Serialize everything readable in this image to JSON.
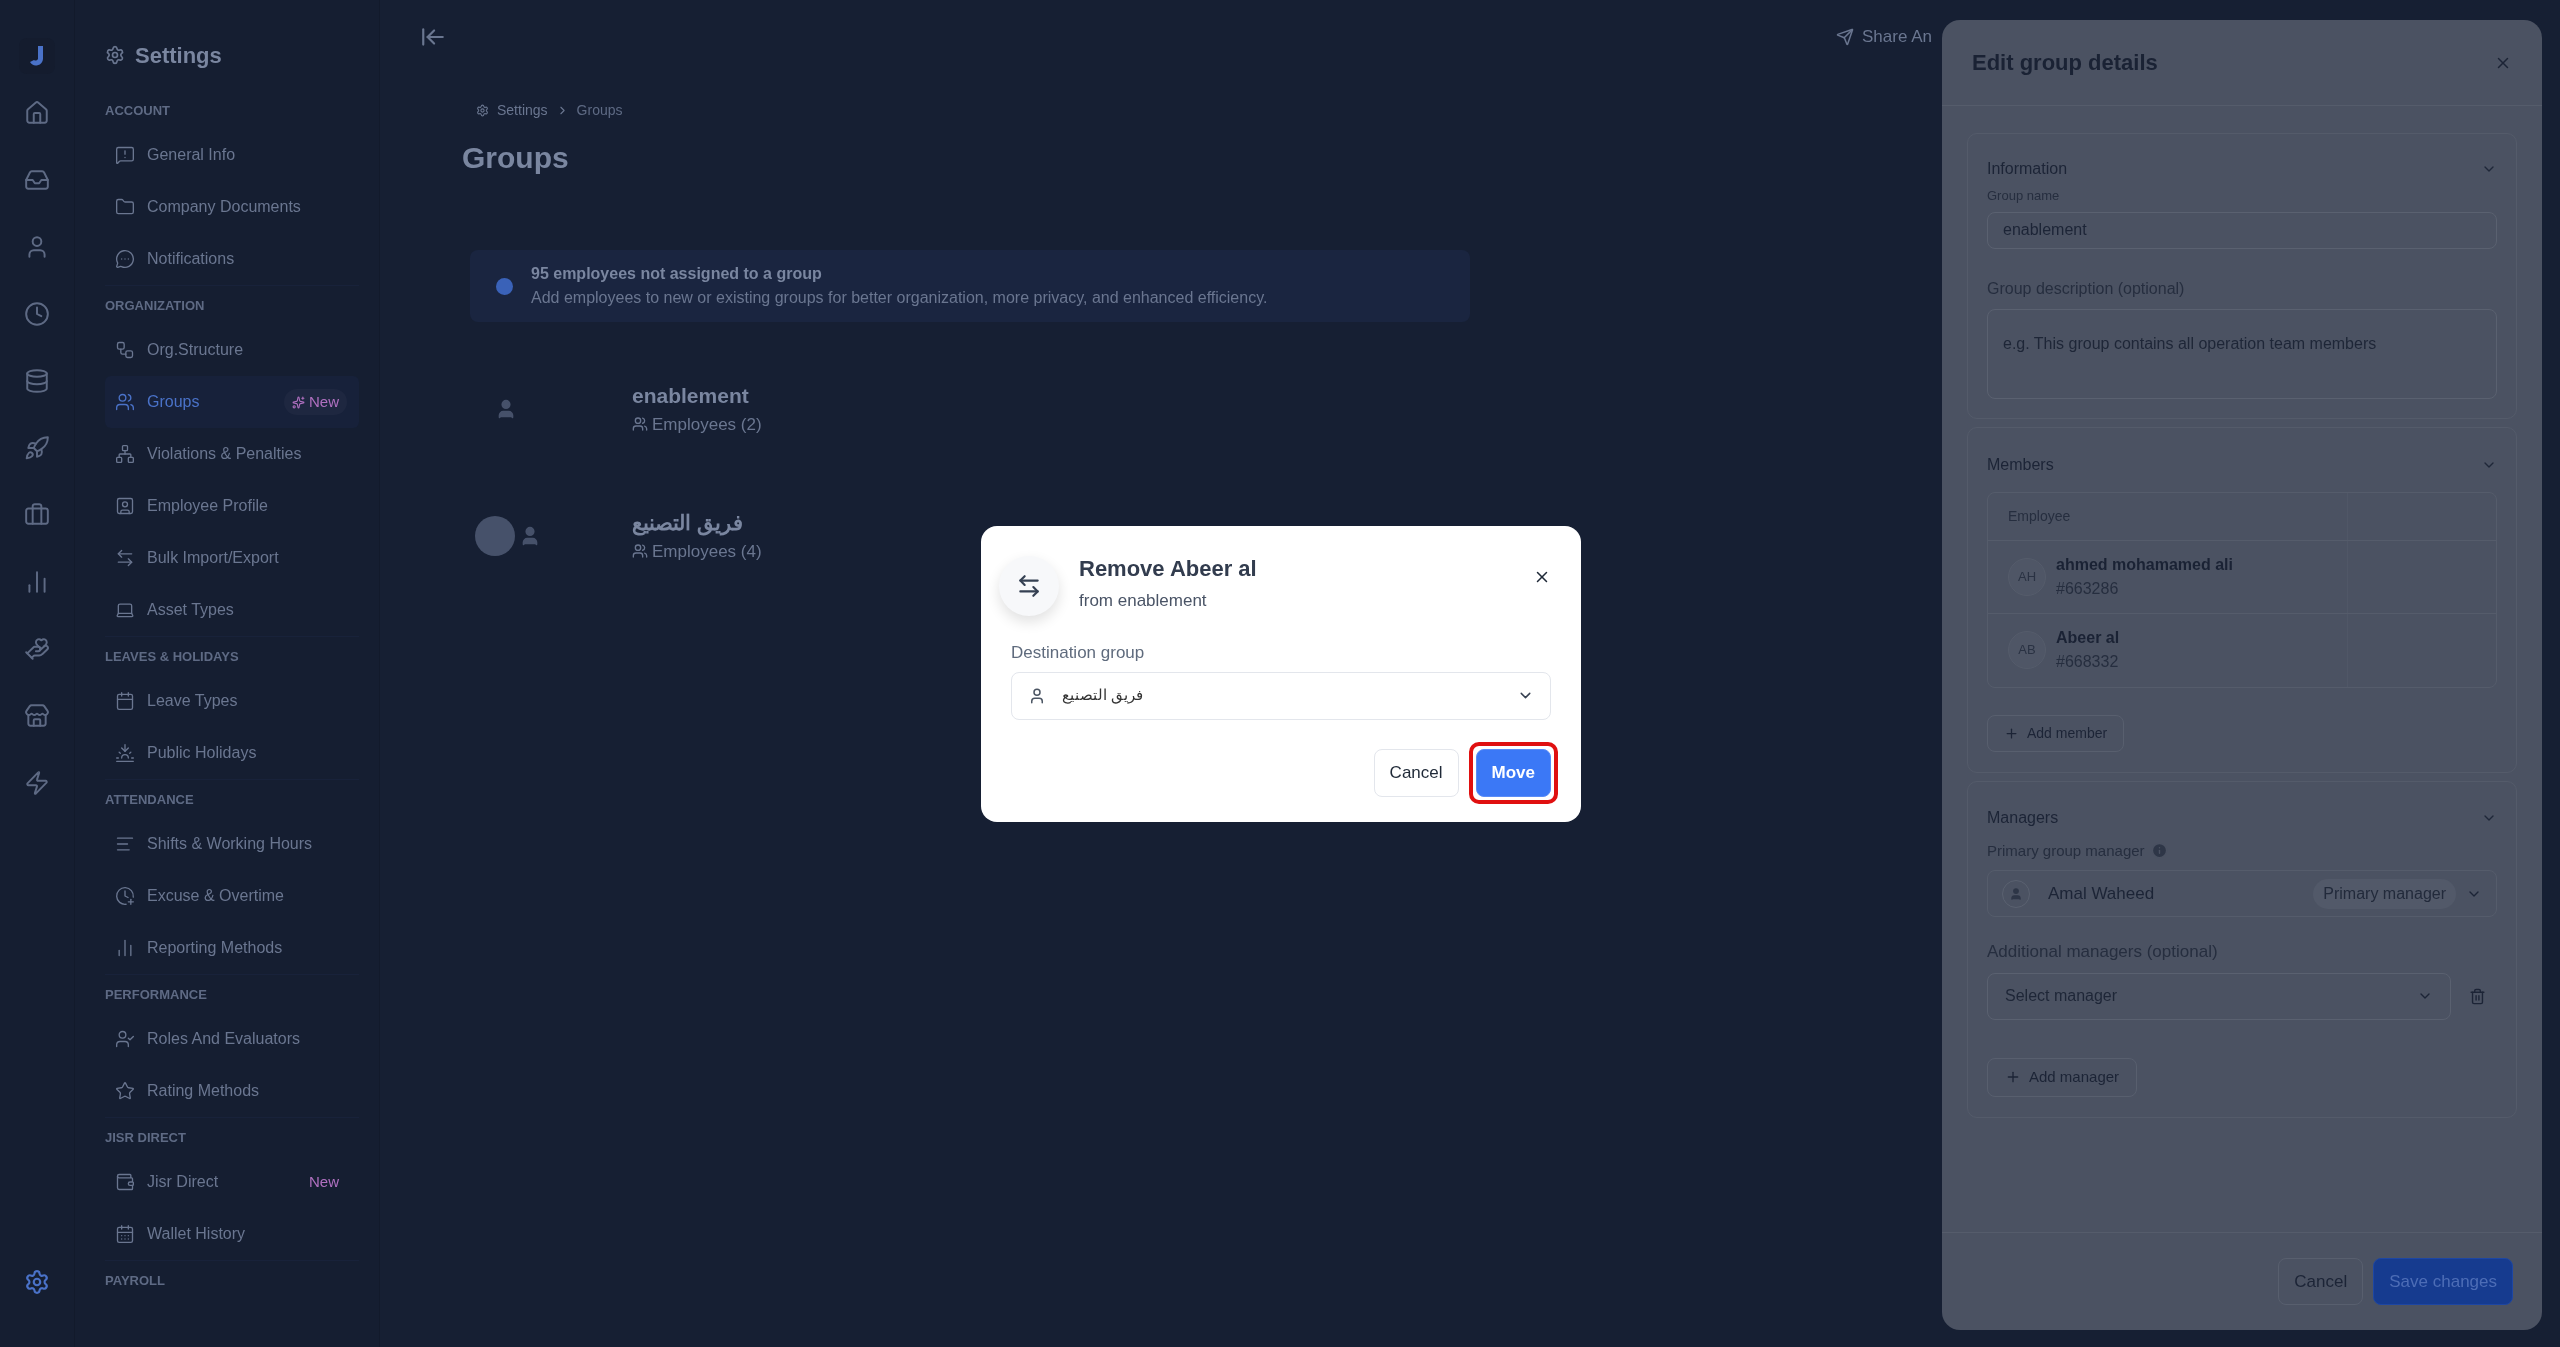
{
  "sidebar": {
    "title": "Settings",
    "sections": [
      {
        "label": "ACCOUNT",
        "items": [
          {
            "label": "General Info",
            "selected": false
          },
          {
            "label": "Company Documents",
            "selected": false
          },
          {
            "label": "Notifications",
            "selected": false
          }
        ]
      },
      {
        "label": "ORGANIZATION",
        "items": [
          {
            "label": "Org.Structure",
            "selected": false
          },
          {
            "label": "Groups",
            "selected": true,
            "badge": {
              "text": "New",
              "kind": "sparkle"
            }
          },
          {
            "label": "Violations & Penalties",
            "selected": false
          },
          {
            "label": "Employee Profile",
            "selected": false
          },
          {
            "label": "Bulk Import/Export",
            "selected": false
          },
          {
            "label": "Asset Types",
            "selected": false
          }
        ]
      },
      {
        "label": "LEAVES & HOLIDAYS",
        "items": [
          {
            "label": "Leave Types",
            "selected": false
          },
          {
            "label": "Public Holidays",
            "selected": false
          }
        ]
      },
      {
        "label": "ATTENDANCE",
        "items": [
          {
            "label": "Shifts & Working Hours",
            "selected": false
          },
          {
            "label": "Excuse & Overtime",
            "selected": false
          },
          {
            "label": "Reporting Methods",
            "selected": false
          }
        ]
      },
      {
        "label": "PERFORMANCE",
        "items": [
          {
            "label": "Roles And Evaluators",
            "selected": false
          },
          {
            "label": "Rating Methods",
            "selected": false
          }
        ]
      },
      {
        "label": "JISR DIRECT",
        "items": [
          {
            "label": "Jisr Direct",
            "selected": false,
            "badge": {
              "text": "New",
              "kind": "plain"
            }
          },
          {
            "label": "Wallet History",
            "selected": false
          }
        ]
      },
      {
        "label": "PAYROLL"
      }
    ]
  },
  "topbar": {
    "share": "Share An"
  },
  "breadcrumb": [
    "Settings",
    "Groups"
  ],
  "page_title": "Groups",
  "banner": {
    "title": "95 employees not assigned to a group",
    "text": "Add employees to new or existing groups for better organization, more privacy, and enhanced efficiency."
  },
  "groups": [
    {
      "name": "enablement",
      "employees": "Employees (2)",
      "photo": false
    },
    {
      "name": "فريق التصنيع",
      "employees": "Employees (4)",
      "photo": true
    }
  ],
  "panel": {
    "title": "Edit group details",
    "information": {
      "title": "Information",
      "name_label": "Group name",
      "name_value": "enablement",
      "desc_label": "Group description (optional)",
      "desc_placeholder": "e.g. This group contains all operation team members"
    },
    "members": {
      "title": "Members",
      "column": "Employee",
      "rows": [
        {
          "initials": "AH",
          "name": "ahmed mohamamed ali",
          "id": "#663286"
        },
        {
          "initials": "AB",
          "name": "Abeer al",
          "id": "#668332"
        }
      ],
      "add": "Add member"
    },
    "managers": {
      "title": "Managers",
      "primary_label": "Primary group manager",
      "primary_name": "Amal Waheed",
      "primary_tag": "Primary manager",
      "additional_label": "Additional managers (optional)",
      "additional_placeholder": "Select manager",
      "add": "Add manager"
    },
    "cancel": "Cancel",
    "save": "Save changes"
  },
  "dialog": {
    "title": "Remove Abeer al",
    "subtitle": "from enablement",
    "field_label": "Destination group",
    "field_value": "فريق التصنيع",
    "cancel": "Cancel",
    "confirm": "Move",
    "confirm_highlighted": true
  }
}
